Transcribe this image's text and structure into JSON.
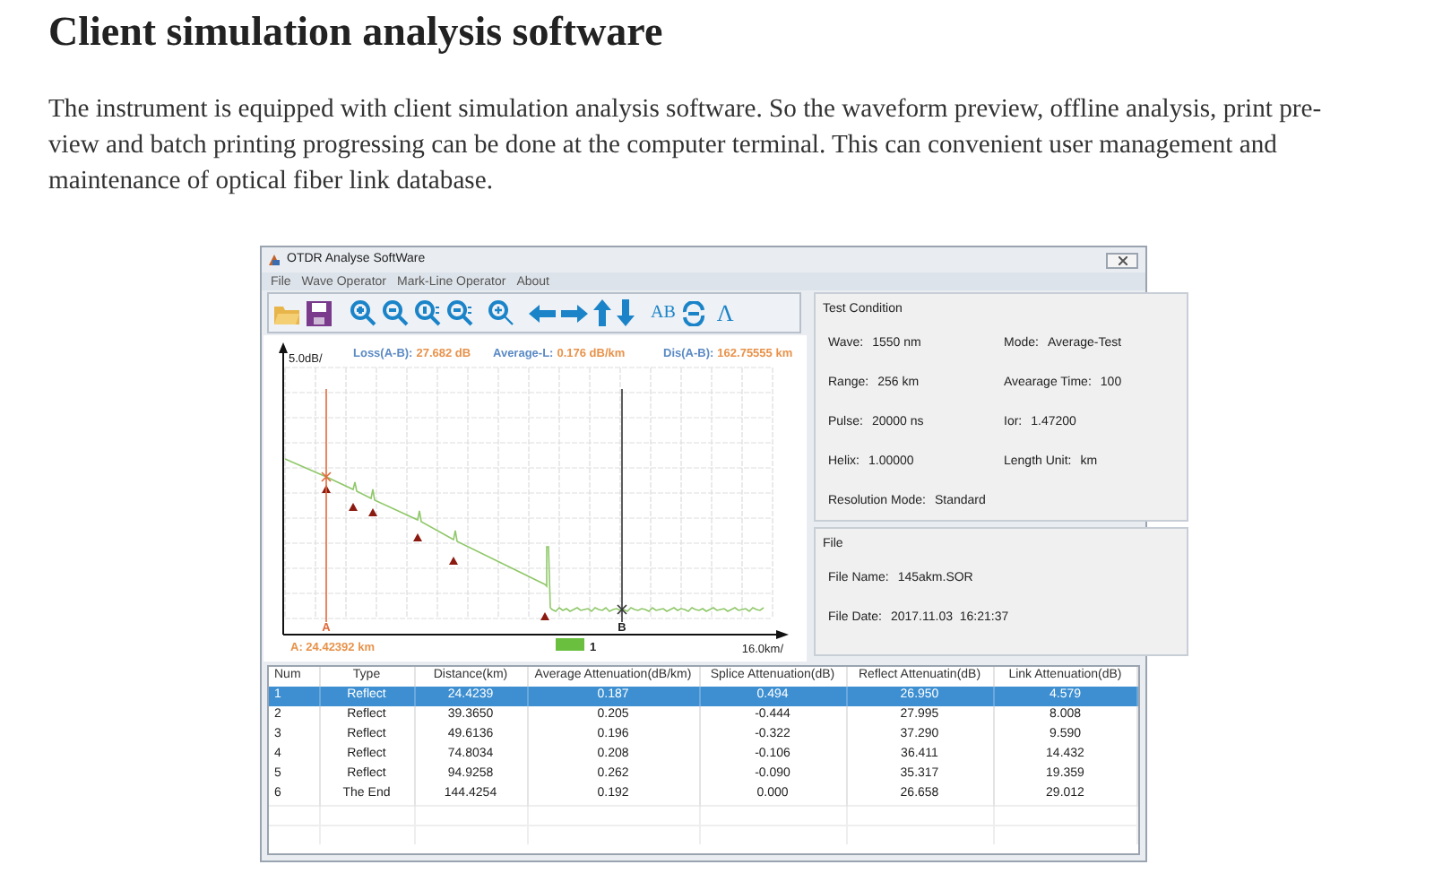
{
  "heading": "Client simulation analysis software",
  "paragraph": "The instrument is equipped with client simulation analysis software. So the waveform preview, offline analysis, print pre-view and batch printing progressing can be done at the computer terminal. This can convenient user management and maintenance of optical fiber link database.",
  "app": {
    "title": "OTDR Analyse SoftWare",
    "menu": [
      "File",
      "Wave Operator",
      "Mark-Line Operator",
      "About"
    ],
    "toolbar_labels": [
      "AB",
      "Λ"
    ],
    "chart": {
      "y_scale": "5.0dB/",
      "x_scale": "16.0km/",
      "measures": [
        {
          "label": "Loss(A-B):",
          "value": "27.682 dB"
        },
        {
          "label": "Average-L:",
          "value": "0.176 dB/km"
        },
        {
          "label": "Dis(A-B):",
          "value": "162.75555 km"
        }
      ],
      "cursor_a": "A",
      "cursor_b": "B",
      "cursor_a_reading": "A: 24.42392 km",
      "legend": "1"
    },
    "test_condition": {
      "title": "Test Condition",
      "rows": [
        [
          {
            "label": "Wave:",
            "value": "1550 nm"
          },
          {
            "label": "Mode:",
            "value": "Average-Test"
          }
        ],
        [
          {
            "label": "Range:",
            "value": "256 km"
          },
          {
            "label": "Avearage Time:",
            "value": "100"
          }
        ],
        [
          {
            "label": "Pulse:",
            "value": "20000 ns"
          },
          {
            "label": "Ior:",
            "value": "1.47200"
          }
        ],
        [
          {
            "label": "Helix:",
            "value": "1.00000"
          },
          {
            "label": "Length Unit:",
            "value": "km"
          }
        ],
        [
          {
            "label": "Resolution Mode:",
            "value": "Standard"
          }
        ]
      ]
    },
    "file": {
      "title": "File",
      "fields": [
        {
          "label": "File Name:",
          "value": "145akm.SOR"
        },
        {
          "label": "File Date:",
          "value": "2017.11.03  16:21:37"
        }
      ]
    },
    "table": {
      "columns": [
        "Num",
        "Type",
        "Distance(km)",
        "Average Attenuation(dB/km)",
        "Splice Attenuation(dB)",
        "Reflect Attenuatin(dB)",
        "Link Attenuation(dB)"
      ],
      "rows": [
        {
          "cells": [
            "1",
            "Reflect",
            "24.4239",
            "0.187",
            "0.494",
            "26.950",
            "4.579"
          ],
          "selected": true
        },
        {
          "cells": [
            "2",
            "Reflect",
            "39.3650",
            "0.205",
            "-0.444",
            "27.995",
            "8.008"
          ],
          "selected": false
        },
        {
          "cells": [
            "3",
            "Reflect",
            "49.6136",
            "0.196",
            "-0.322",
            "37.290",
            "9.590"
          ],
          "selected": false
        },
        {
          "cells": [
            "4",
            "Reflect",
            "74.8034",
            "0.208",
            "-0.106",
            "36.411",
            "14.432"
          ],
          "selected": false
        },
        {
          "cells": [
            "5",
            "Reflect",
            "94.9258",
            "0.262",
            "-0.090",
            "35.317",
            "19.359"
          ],
          "selected": false
        },
        {
          "cells": [
            "6",
            "The End",
            "144.4254",
            "0.192",
            "0.000",
            "26.658",
            "29.012"
          ],
          "selected": false
        }
      ]
    }
  }
}
